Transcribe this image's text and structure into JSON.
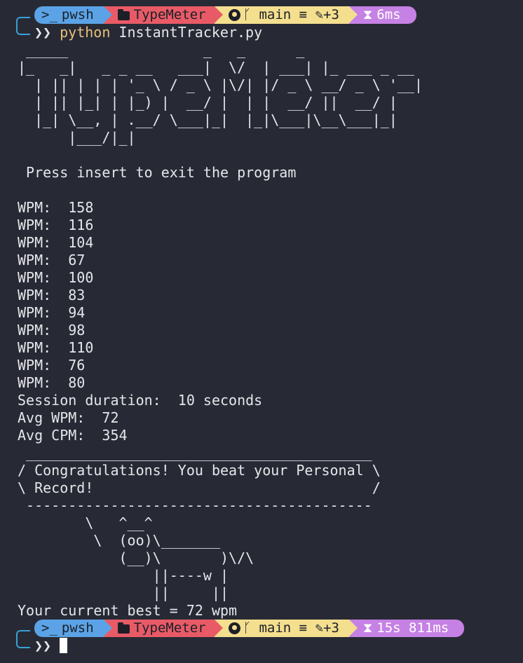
{
  "prompt": {
    "shell": "pwsh",
    "directory": "TypeMeter",
    "branch": "main",
    "branch_status": "≡",
    "changes": "+3",
    "last_duration": "6ms",
    "chevron": "❯❯",
    "colors": {
      "pwsh": "#5ba3e6",
      "dir": "#e85b66",
      "git": "#f4df8f",
      "time": "#c681e4"
    }
  },
  "command": {
    "interpreter": "python",
    "args": "InstantTracker.py"
  },
  "banner": " _____                _   _      _\n|_   _|   _ _ __   ___|  \\/  | ___| |_ ___ _ __\n  | || | | | '_ \\ / _ \\ |\\/| |/ _ \\ __/ _ \\ '__|\n  | || |_| | |_) |  __/ |  | |  __/ ||  __/ |\n  |_| \\__, | .__/ \\___|_|  |_|\\___|\\__\\___|_|\n      |___/|_|",
  "instruction": " Press insert to exit the program",
  "wpm_label": "WPM:  ",
  "wpm_readings": [
    "158",
    "116",
    "104",
    "67",
    "100",
    "83",
    "94",
    "98",
    "110",
    "76",
    "80"
  ],
  "summary": {
    "duration": "Session duration:  10 seconds",
    "avg_wpm": "Avg WPM:  72",
    "avg_cpm": "Avg CPM:  354"
  },
  "cowsay": " _________________________________________\n/ Congratulations! You beat your Personal \\\n\\ Record!                                 /\n -----------------------------------------\n        \\   ^__^\n         \\  (oo)\\_______\n            (__)\\       )\\/\\\n                ||----w |\n                ||     ||",
  "best": "Your current best = 72 wpm",
  "prompt2": {
    "shell": "pwsh",
    "directory": "TypeMeter",
    "branch": "main",
    "branch_status": "≡",
    "changes": "+3",
    "last_duration": "15s 811ms",
    "chevron": "❯❯"
  }
}
